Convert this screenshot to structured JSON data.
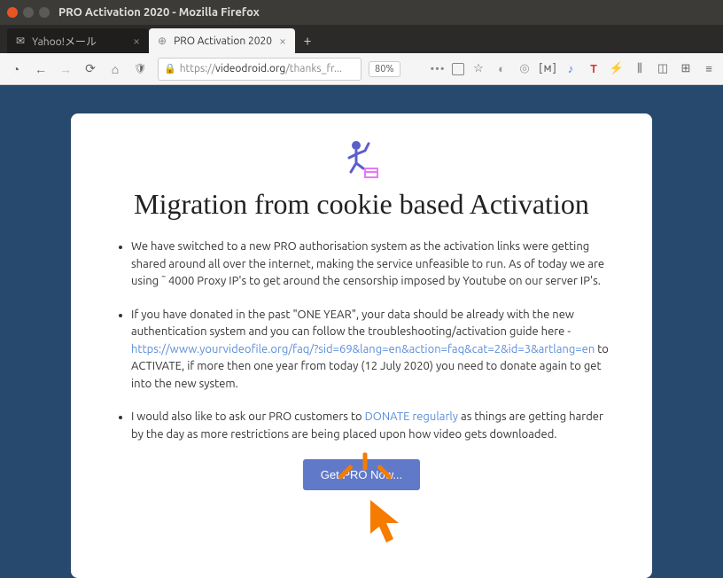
{
  "window": {
    "title": "PRO Activation 2020 - Mozilla Firefox"
  },
  "tabs": {
    "inactive": "Yahoo!メール",
    "active": "PRO Activation 2020"
  },
  "url": {
    "proto": "https://",
    "host": "videodroid.org",
    "rest": "/thanks_fr..."
  },
  "zoom": "80%",
  "page": {
    "heading": "Migration from cookie based Activation",
    "bullet1": "We have switched to a new PRO authorisation system as the activation links were getting shared around all over the internet, making the service unfeasible to run. As of today we are using ˜ 4000 Proxy IP's to get around the censorship imposed by Youtube on our server IP's.",
    "bullet2_a": "If you have donated in the past \"ONE YEAR\", your data should be already with the new authentication system and you can follow the troubleshooting/activation guide here - ",
    "bullet2_link": "https://www.yourvideofile.org/faq/?sid=69&lang=en&action=faq&cat=2&id=3&artlang=en",
    "bullet2_b": " to ACTIVATE, if more then one year from today (12 July 2020) you need to donate again to get into the new system.",
    "bullet3_a": "I would also like to ask our PRO customers to ",
    "bullet3_link": "DONATE regularly",
    "bullet3_b": " as things are getting harder by the day as more restrictions are being placed upon how video gets downloaded.",
    "cta": "Get PRO Now..."
  }
}
